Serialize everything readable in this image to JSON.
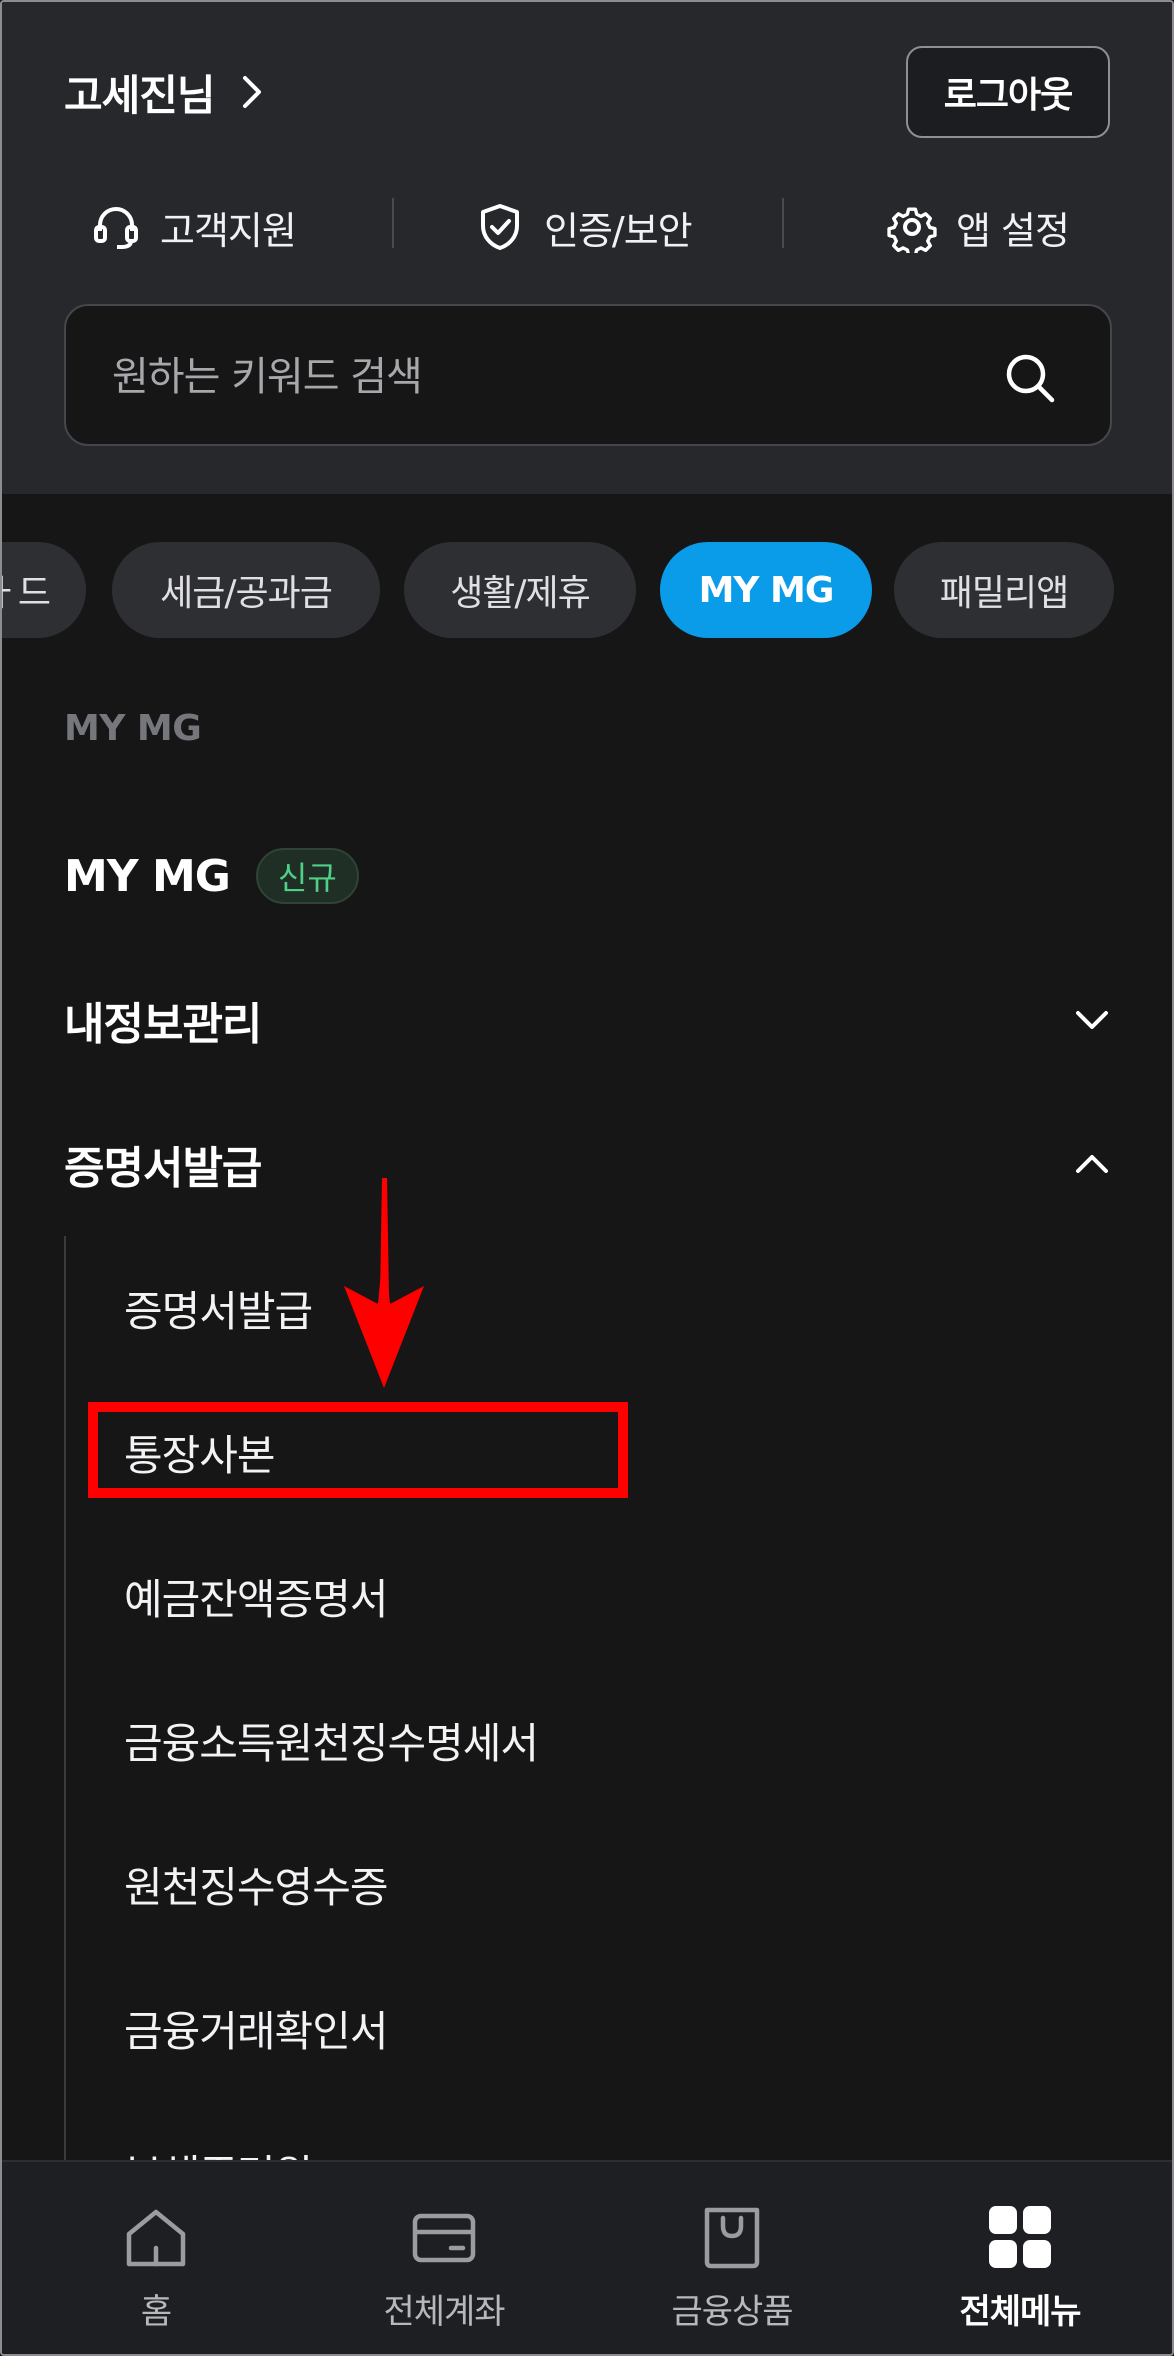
{
  "header": {
    "user_name": "고세진님",
    "logout_label": "로그아웃",
    "utilities": [
      {
        "label": "고객지원",
        "icon": "headset-icon"
      },
      {
        "label": "인증/보안",
        "icon": "shield-check-icon"
      },
      {
        "label": "앱 설정",
        "icon": "gear-icon"
      }
    ],
    "search": {
      "placeholder": "원하는 키워드 검색",
      "value": ""
    }
  },
  "chips": [
    {
      "label": "카드",
      "visible_text": "ㅏ드",
      "active": false
    },
    {
      "label": "세금/공과금",
      "active": false
    },
    {
      "label": "생활/제휴",
      "active": false
    },
    {
      "label": "MY MG",
      "active": true
    },
    {
      "label": "패밀리앱",
      "active": false
    }
  ],
  "menu": {
    "section_label": "MY MG",
    "items": [
      {
        "label": "MY MG",
        "badge": "신규"
      },
      {
        "label": "내정보관리",
        "expanded": false
      },
      {
        "label": "증명서발급",
        "expanded": true
      }
    ],
    "submenu": [
      "증명서발급",
      "통장사본",
      "예금잔액증명서",
      "금융소득원천징수명세서",
      "원천징수영수증",
      "금융거래확인서",
      "부채증명원"
    ],
    "highlighted_item": "통장사본"
  },
  "bottom_nav": [
    {
      "label": "홈",
      "icon": "home-icon",
      "active": false
    },
    {
      "label": "전체계좌",
      "icon": "card-icon",
      "active": false
    },
    {
      "label": "금융상품",
      "icon": "shopping-bag-icon",
      "active": false
    },
    {
      "label": "전체메뉴",
      "icon": "grid-menu-icon",
      "active": true
    }
  ],
  "colors": {
    "accent": "#0a9be9",
    "badge_green": "#4fcf87",
    "annotation_red": "#ff0000",
    "header_bg": "#27282c",
    "body_bg": "#161617"
  }
}
